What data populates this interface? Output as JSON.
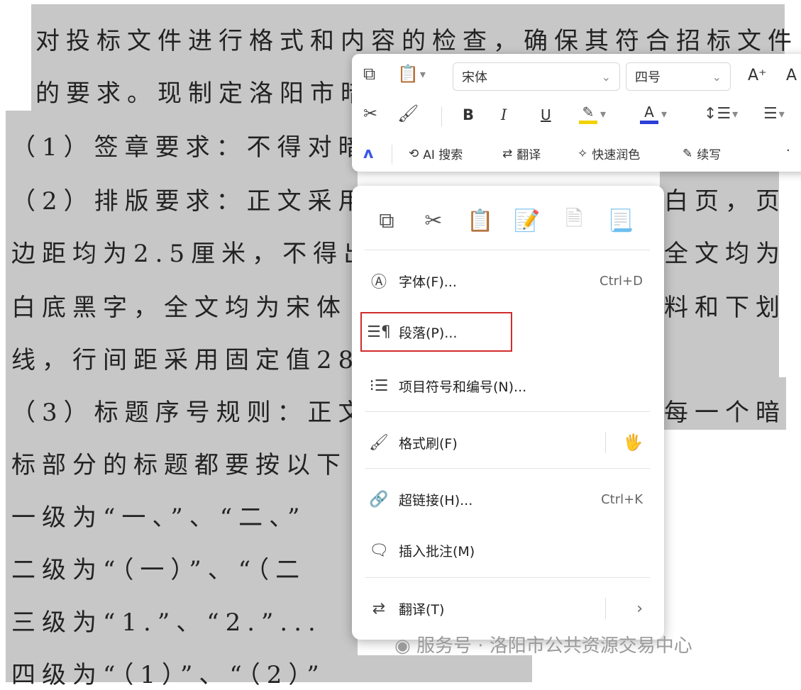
{
  "document": {
    "lines": [
      "对投标文件进行格式和内容的检查，确保其符合招标文件",
      "的要求。现制定洛阳市暗",
      "（1）签章要求：不得对暗",
      "（2）排版要求：正文采用",
      "边距均为2.5厘米，不得出",
      "白底黑字，全文均为宋体",
      "线，行间距采用固定值28",
      "（3）标题序号规则：正文",
      "标部分的标题都要按以下",
      "一级为“一、”、“二、”",
      "二级为“（一）”、“（二",
      "三级为“1.”、“2.”...",
      "四级为“（1）”、“（2）”"
    ],
    "right_fragments": [
      "白页，页",
      "全文均为",
      "料和下划",
      "每一个暗"
    ]
  },
  "toolbar": {
    "font_name": "宋体",
    "font_size": "四号",
    "bold": "B",
    "italic": "I",
    "underline": "U",
    "ai_search": "AI 搜索",
    "translate": "翻译",
    "polish": "快速润色",
    "continue_write": "续写"
  },
  "menu": {
    "items": [
      {
        "label": "字体(F)...",
        "shortcut": "Ctrl+D"
      },
      {
        "label": "段落(P)..."
      },
      {
        "label": "项目符号和编号(N)..."
      },
      {
        "label": "格式刷(F)"
      },
      {
        "label": "超链接(H)...",
        "shortcut": "Ctrl+K"
      },
      {
        "label": "插入批注(M)"
      },
      {
        "label": "翻译(T)"
      }
    ]
  },
  "watermark": "服务号 · 洛阳市公共资源交易中心",
  "colors": {
    "selection": "#c7c7c7",
    "highlight_border": "#d12b2b",
    "highlight_color_bar": "#f2d200",
    "font_color_bar": "#2b3fd6"
  },
  "icons": [
    "copy-icon",
    "paste-icon",
    "cut-icon",
    "format-painter-icon",
    "font-icon",
    "paragraph-icon",
    "list-icon",
    "hyperlink-icon",
    "comment-icon",
    "translate-icon",
    "ai-logo-icon"
  ]
}
